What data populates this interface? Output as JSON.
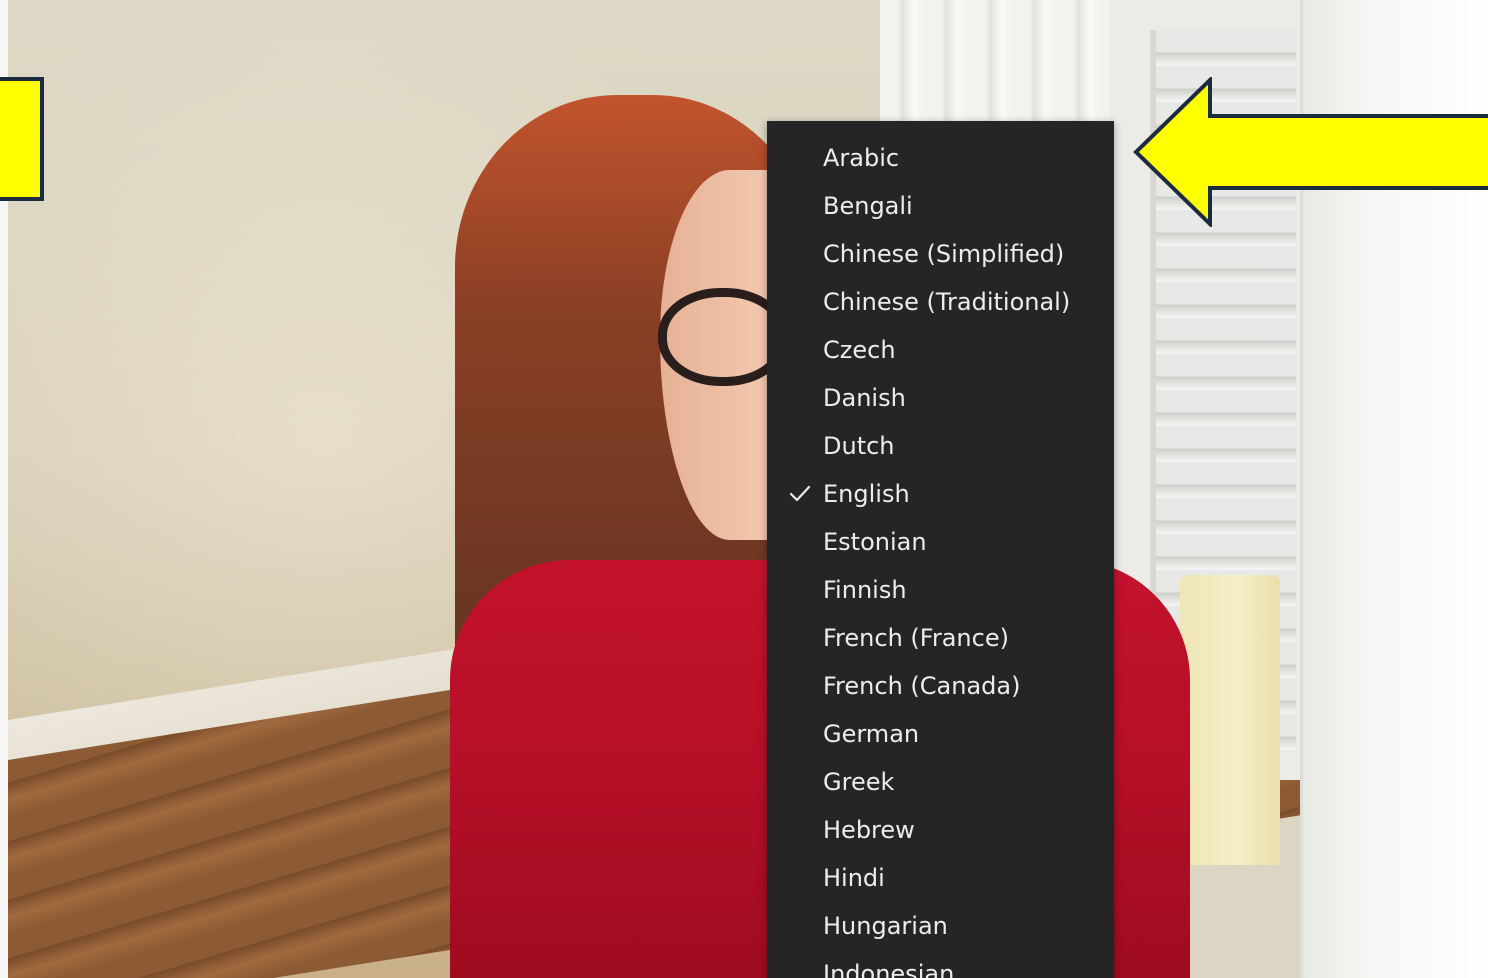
{
  "menu": {
    "selected": "English",
    "items": [
      {
        "label": "Arabic",
        "checked": false
      },
      {
        "label": "Bengali",
        "checked": false
      },
      {
        "label": "Chinese (Simplified)",
        "checked": false
      },
      {
        "label": "Chinese (Traditional)",
        "checked": false
      },
      {
        "label": "Czech",
        "checked": false
      },
      {
        "label": "Danish",
        "checked": false
      },
      {
        "label": "Dutch",
        "checked": false
      },
      {
        "label": "English",
        "checked": true
      },
      {
        "label": "Estonian",
        "checked": false
      },
      {
        "label": "Finnish",
        "checked": false
      },
      {
        "label": "French (France)",
        "checked": false
      },
      {
        "label": "French (Canada)",
        "checked": false
      },
      {
        "label": "German",
        "checked": false
      },
      {
        "label": "Greek",
        "checked": false
      },
      {
        "label": "Hebrew",
        "checked": false
      },
      {
        "label": "Hindi",
        "checked": false
      },
      {
        "label": "Hungarian",
        "checked": false
      },
      {
        "label": "Indonesian",
        "checked": false
      }
    ]
  },
  "icons": {
    "check": "check-icon",
    "arrow": "arrow-left-icon"
  },
  "colors": {
    "menu_background": "#252526",
    "menu_text": "#ececec",
    "highlight_yellow": "#ffff00",
    "highlight_outline": "#1c2b3d"
  }
}
